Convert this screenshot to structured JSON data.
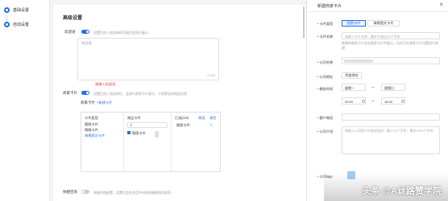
{
  "steps": [
    {
      "label": "基础设置"
    },
    {
      "label": "自动设置"
    }
  ],
  "main": {
    "title": "高级设置",
    "welcome": {
      "label": "欢迎语",
      "hint": "设置后进入该咨询的页面后会进行展示",
      "placeholder": "欢迎语",
      "counter": "0/150",
      "error": "请输入欢迎语"
    },
    "service_card": {
      "label": "商家卡片",
      "hint": "设置后进入该咨询后，会进行商家卡片展示，介绍等业务相关信息",
      "card_label": "商家卡片",
      "add_link": "+新建卡片",
      "col1_head": "卡片类型",
      "col1_items": [
        "图图卡片",
        "跳跳卡片",
        "海报图文卡片"
      ],
      "col2_head": "商品卡片",
      "search_icon": "search-icon",
      "col2_item": "图图卡片",
      "col3_head": "已选(1/3)",
      "col3_filter": "筛选",
      "col3_clear": "清空",
      "col3_item": "图图卡片"
    },
    "quick_menu": {
      "label": "快捷咨询",
      "hint": "快捷导航配置，设置后会在会话中出现快捷按钮内容项"
    }
  },
  "drawer": {
    "title": "新建商家卡片",
    "close_icon": "close-icon",
    "fields": {
      "card_type": {
        "label": "卡片类型",
        "options": [
          "图图卡片",
          "海报图文卡片"
        ],
        "active": 0
      },
      "card_name": {
        "label": "卡片名称",
        "placeholder": "请输入卡片名称，最多不超过40个字符",
        "hint": "新建的商家卡片会在商家卡片中展示，后续可在商家卡片设置进行修改"
      },
      "company": {
        "label": "公司名称"
      },
      "address": {
        "label": "公司地址",
        "button": "添加地址"
      },
      "business_hours": {
        "label": "服务时间",
        "start_day": "星期一",
        "end_day": "星期日",
        "start_time": "09:00",
        "end_time": "18:00"
      },
      "phone": {
        "label": "客户电话"
      },
      "intro": {
        "label": "公司介绍",
        "placeholder": "请输入公司简介内容或描述，最少20个字符，最多4000个字符"
      },
      "logo": {
        "label": "公司logo"
      }
    }
  },
  "watermark": "头条 @A丝路赞学院"
}
